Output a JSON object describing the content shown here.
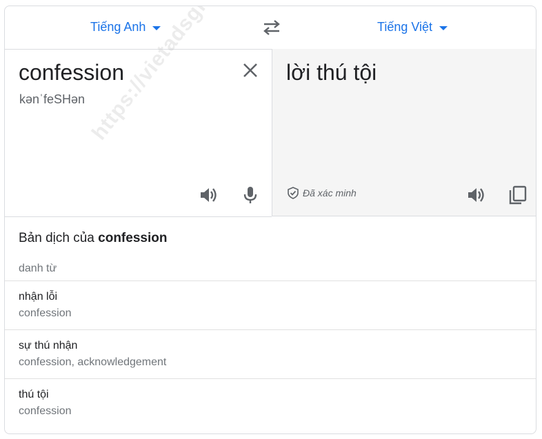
{
  "languages": {
    "source": "Tiếng Anh",
    "target": "Tiếng Việt"
  },
  "source": {
    "text": "confession",
    "transliteration": "kənˈfeSHən"
  },
  "target": {
    "text": "lời thú tội",
    "verified_label": "Đã xác minh"
  },
  "dictionary": {
    "title_prefix": "Bản dịch của",
    "title_word": "confession",
    "part_of_speech": "danh từ",
    "entries": [
      {
        "term": "nhận lỗi",
        "synonyms": "confession"
      },
      {
        "term": "sự thú nhận",
        "synonyms": "confession, acknowledgement"
      },
      {
        "term": "thú tội",
        "synonyms": "confession"
      }
    ]
  },
  "watermark": "https://vietadsgroup.vn",
  "colors": {
    "accent": "#1a73e8",
    "icon": "#5f6368",
    "border": "#dadce0",
    "target_bg": "#f5f5f5"
  }
}
